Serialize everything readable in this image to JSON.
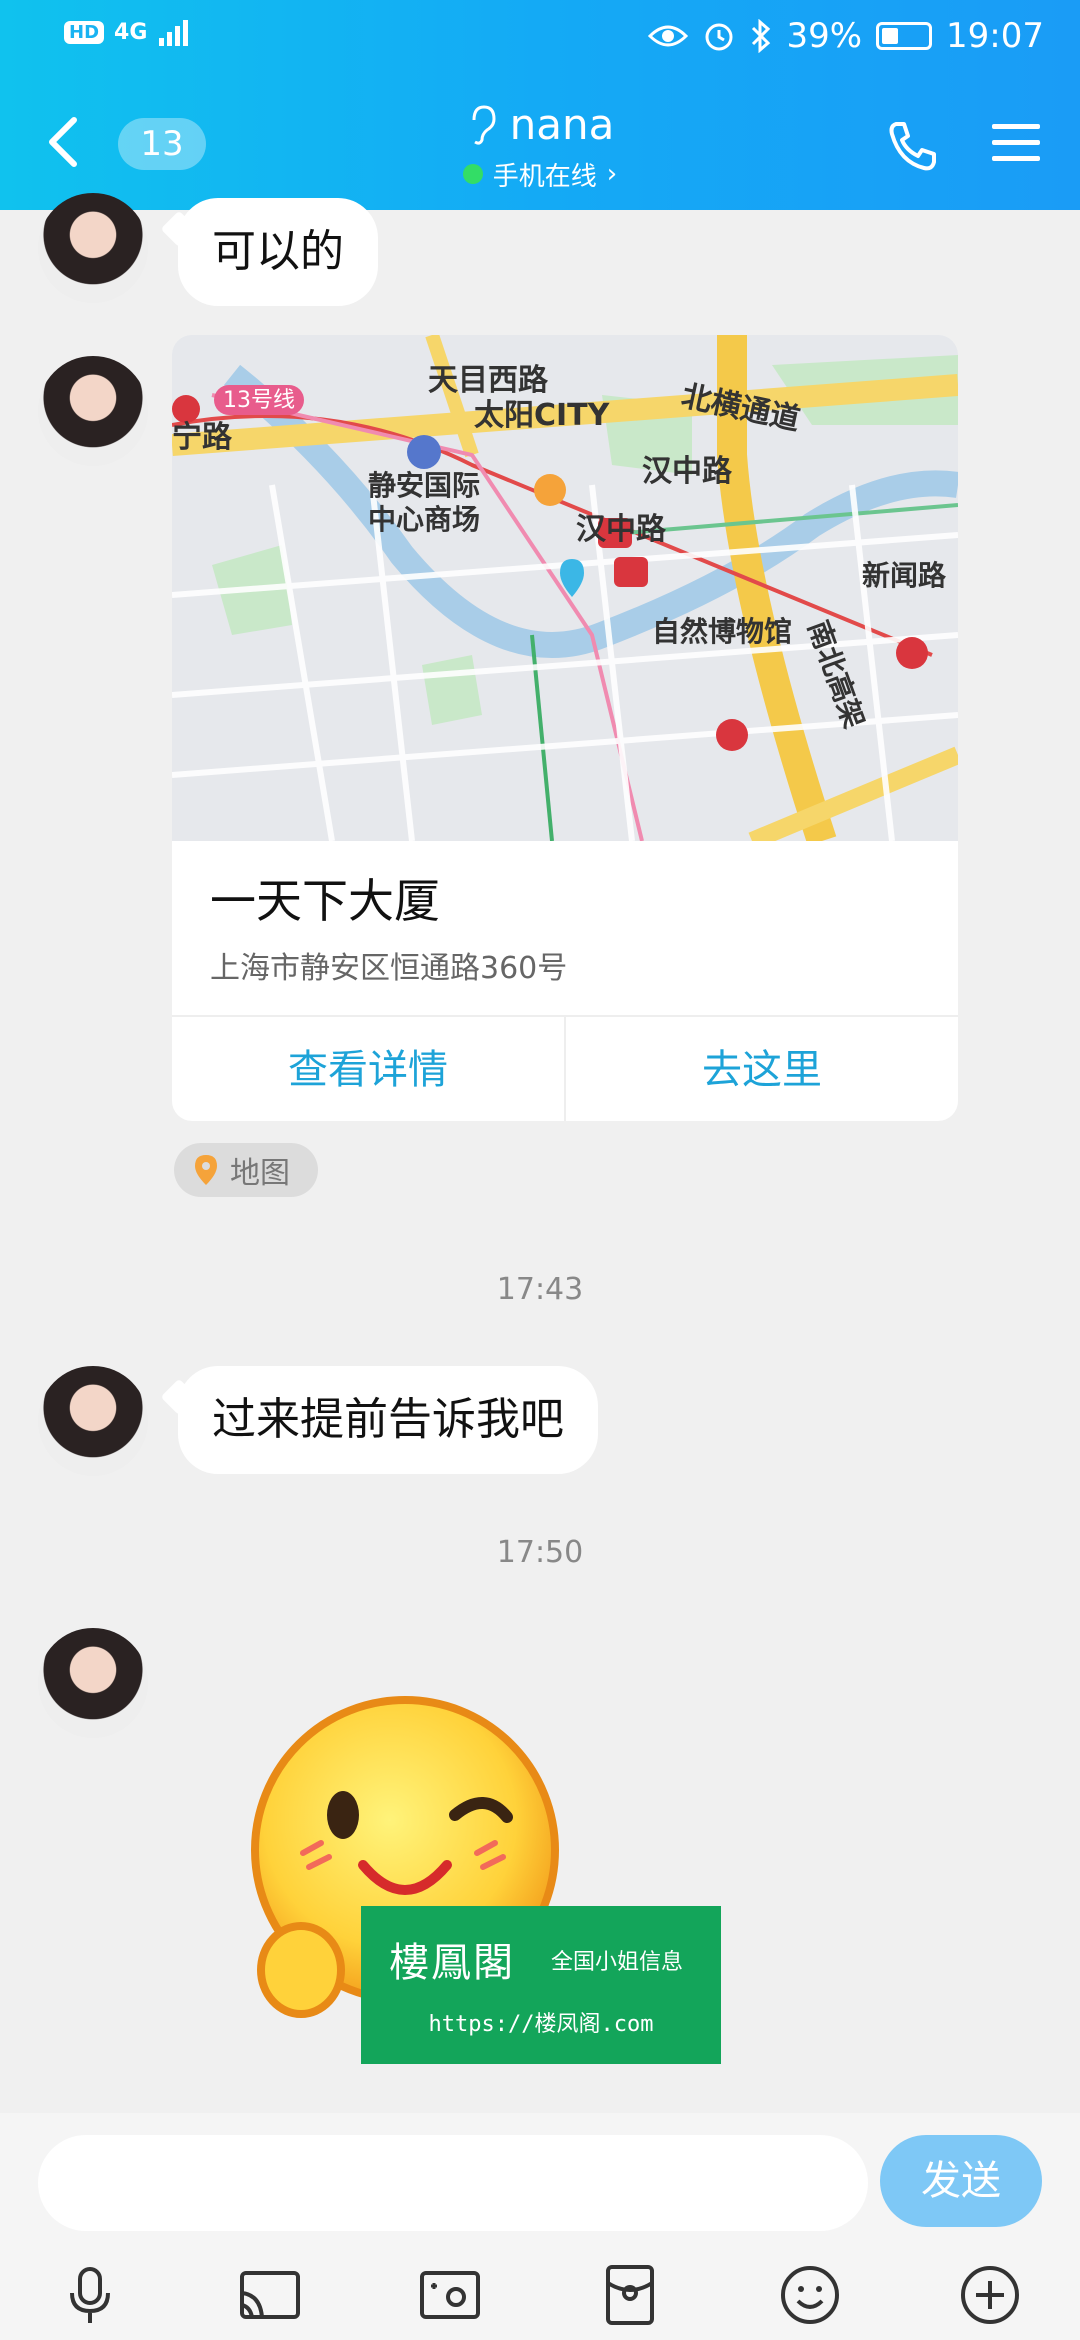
{
  "status_bar": {
    "hd": "HD",
    "network": "4G",
    "battery": "39%",
    "time": "19:07"
  },
  "header": {
    "unread_count": "13",
    "contact_name": "nana",
    "online_status": "手机在线",
    "online_chevron": "›"
  },
  "messages": [
    {
      "type": "text",
      "text": "可以的"
    },
    {
      "type": "location",
      "title": "一天下大厦",
      "address": "上海市静安区恒通路360号",
      "view_details": "查看详情",
      "go_here": "去这里",
      "map_labels": {
        "road_tianmu": "天目西路",
        "road_beiheng": "北横通道",
        "line13": "13号线",
        "ninglu": "宁路",
        "taiyang": "太阳CITY",
        "jingan1": "静安国际",
        "jingan2": "中心商场",
        "hanzhong_station": "汉中路",
        "hanzhong": "汉中路",
        "xinwen": "新闻路",
        "museum": "自然博物馆",
        "nanbei": "南北高架"
      },
      "source_tag": "地图"
    },
    {
      "type": "time",
      "text": "17:43"
    },
    {
      "type": "text",
      "text": "过来提前告诉我吧"
    },
    {
      "type": "time",
      "text": "17:50"
    },
    {
      "type": "sticker",
      "name": "wink-thumbs-up-emoji"
    }
  ],
  "watermark": {
    "brand": "樓鳳閣",
    "tagline": "全国小姐信息",
    "url": "https://楼凤阁.com"
  },
  "composer": {
    "send_label": "发送",
    "input_value": ""
  },
  "toolbar_icons": [
    "mic-icon",
    "screen-cast-icon",
    "photo-icon",
    "red-packet-icon",
    "emoji-icon",
    "plus-icon"
  ]
}
